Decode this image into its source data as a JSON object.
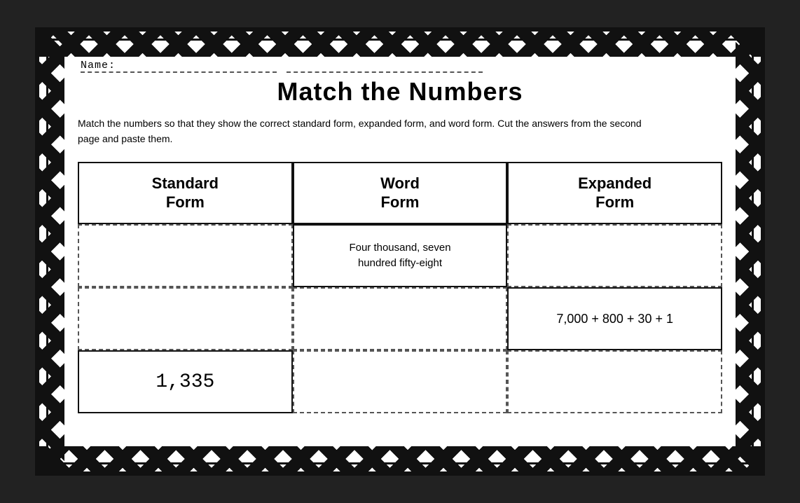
{
  "page": {
    "name_label": "Name:",
    "title": "Match the Numbers",
    "instructions": "Match the numbers so that they show the correct standard form, expanded form, and word form. Cut the answers from the second page and paste them.",
    "table": {
      "headers": [
        "Standard\nForm",
        "Word\nForm",
        "Expanded\nForm"
      ],
      "rows": [
        {
          "standard": "",
          "word": "Four thousand, seven\nhundred fifty-eight",
          "expanded": "",
          "standard_filled": false,
          "word_filled": true,
          "expanded_filled": false
        },
        {
          "standard": "",
          "word": "",
          "expanded": "7,000 + 800 + 30 + 1",
          "standard_filled": false,
          "word_filled": false,
          "expanded_filled": true
        },
        {
          "standard": "1,335",
          "word": "",
          "expanded": "",
          "standard_filled": true,
          "word_filled": false,
          "expanded_filled": false
        }
      ]
    }
  },
  "colors": {
    "border": "#111111",
    "background": "#ffffff",
    "dashed": "#555555"
  }
}
